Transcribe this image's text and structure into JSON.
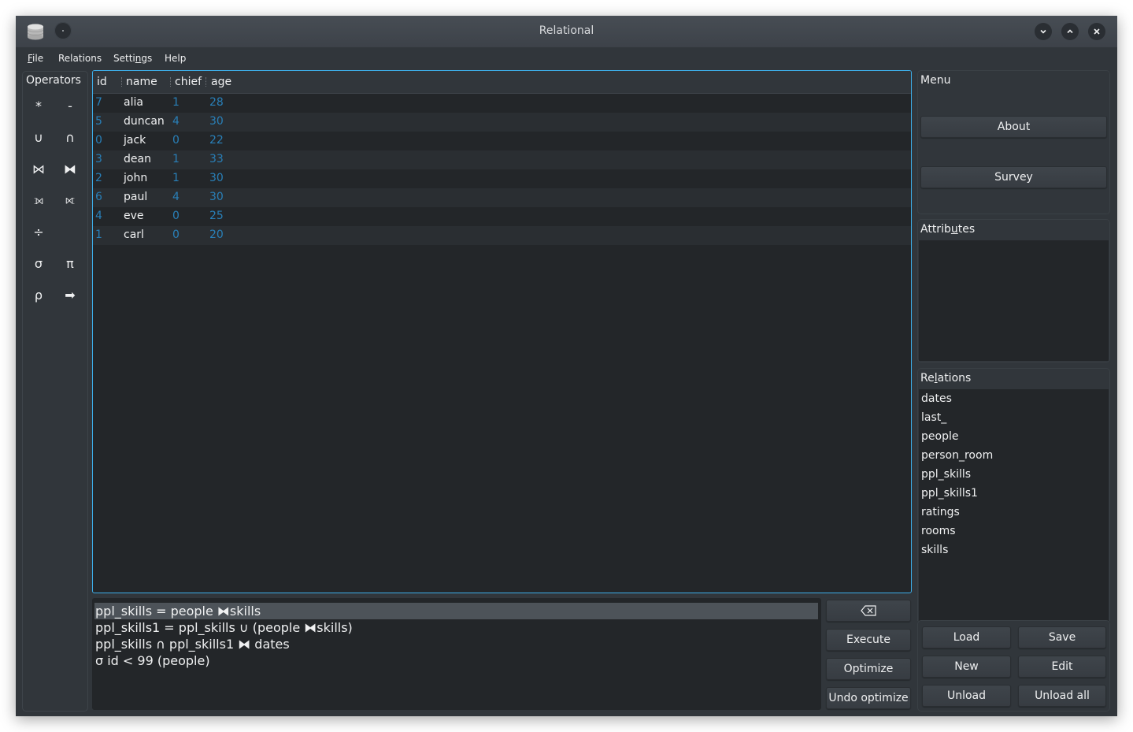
{
  "window": {
    "title": "Relational",
    "controls": {
      "minimize": "⌄",
      "maximize": "⌃",
      "close": "✕"
    }
  },
  "menubar": [
    {
      "label": "File",
      "mnemonic": "F"
    },
    {
      "label": "Relations"
    },
    {
      "label": "Settings",
      "mnemonic": "n"
    },
    {
      "label": "Help"
    }
  ],
  "operators": {
    "title": "Operators",
    "items": [
      {
        "symbol": "*",
        "name": "product"
      },
      {
        "symbol": "-",
        "name": "difference"
      },
      {
        "symbol": "∪",
        "name": "union"
      },
      {
        "symbol": "∩",
        "name": "intersection"
      },
      {
        "symbol": "⋈",
        "name": "natural-join"
      },
      {
        "symbol": "⧓",
        "name": "full-outer-join"
      },
      {
        "symbol": "⟕",
        "name": "left-outer-join"
      },
      {
        "symbol": "⟖",
        "name": "right-outer-join"
      },
      {
        "symbol": "÷",
        "name": "division"
      },
      {
        "symbol": "σ",
        "name": "selection"
      },
      {
        "symbol": "π",
        "name": "projection"
      },
      {
        "symbol": "ρ",
        "name": "rename"
      },
      {
        "symbol": "➡",
        "name": "assignment"
      }
    ]
  },
  "result_table": {
    "columns": [
      "id",
      "name",
      "chief",
      "age"
    ],
    "rows": [
      [
        "7",
        "alia",
        "1",
        "28"
      ],
      [
        "5",
        "duncan",
        "4",
        "30"
      ],
      [
        "0",
        "jack",
        "0",
        "22"
      ],
      [
        "3",
        "dean",
        "1",
        "33"
      ],
      [
        "2",
        "john",
        "1",
        "30"
      ],
      [
        "6",
        "paul",
        "4",
        "30"
      ],
      [
        "4",
        "eve",
        "0",
        "25"
      ],
      [
        "1",
        "carl",
        "0",
        "20"
      ]
    ]
  },
  "history": {
    "items": [
      "ppl_skills = people ⧓skills",
      "ppl_skills1 = ppl_skills ∪ (people ⧓skills)",
      "ppl_skills ∩ ppl_skills1 ⧓ dates",
      "σ id < 99 (people)"
    ],
    "selected_index": 0
  },
  "query_buttons": {
    "clear": "⌫",
    "execute": "Execute",
    "optimize": "Optimize",
    "undo_optimize": "Undo optimize"
  },
  "menu_panel": {
    "title": "Menu",
    "about": "About",
    "survey": "Survey"
  },
  "attributes_panel": {
    "title": "Attributes",
    "mnemonic": "u",
    "items": []
  },
  "relations_panel": {
    "title": "Relations",
    "mnemonic": "l",
    "items": [
      "dates",
      "last_",
      "people",
      "person_room",
      "ppl_skills",
      "ppl_skills1",
      "ratings",
      "rooms",
      "skills"
    ]
  },
  "relation_buttons": {
    "load": "Load",
    "save": "Save",
    "new": "New",
    "edit": "Edit",
    "unload": "Unload",
    "unload_all": "Unload all"
  },
  "colors": {
    "accent": "#3daee9",
    "numeric_text": "#2980b9",
    "window_bg": "#31363b",
    "view_bg": "#232629",
    "text": "#eff0f1"
  }
}
